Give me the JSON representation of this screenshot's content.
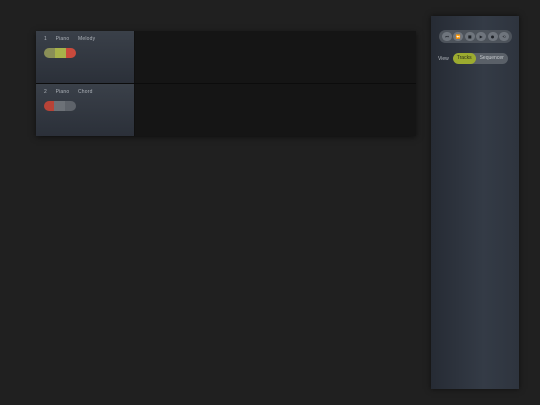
{
  "tracks": [
    {
      "number": "1",
      "instrument": "Piano",
      "name": "Melody",
      "pill_colors": [
        "#8a8f57",
        "#a8b24a",
        "#c94a3c"
      ]
    },
    {
      "number": "2",
      "instrument": "Piano",
      "name": "Chord",
      "pill_colors": [
        "#b84337",
        "#6c7177",
        "#5e636a"
      ]
    }
  ],
  "transport": {
    "buttons": [
      "⏮",
      "⏪",
      "■",
      "▶",
      "●",
      "⟲"
    ],
    "icons": [
      "skip-back-icon",
      "rewind-icon",
      "stop-icon",
      "play-icon",
      "record-icon",
      "loop-icon"
    ]
  },
  "view": {
    "label": "View",
    "options": [
      "Tracks",
      "Sequencer"
    ],
    "active": "Tracks",
    "accent_color": "#9cab2f"
  }
}
